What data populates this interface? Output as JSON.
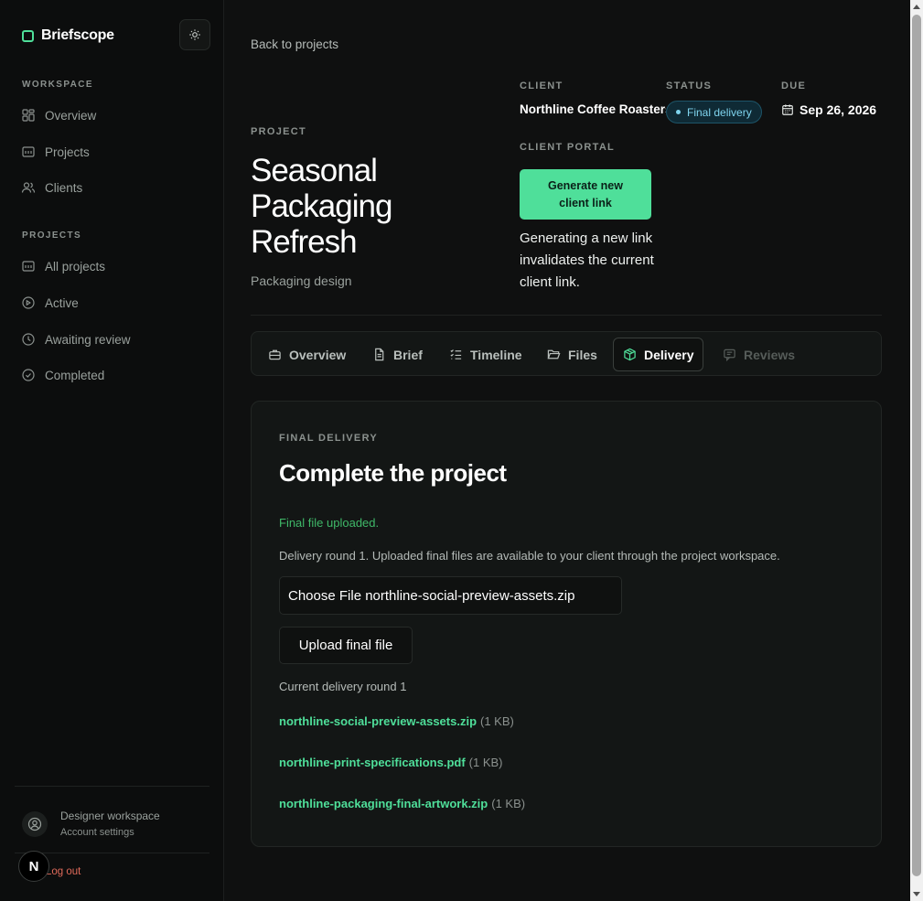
{
  "brand": {
    "name": "Briefscope",
    "accent": "#4fdf9a"
  },
  "sidebar": {
    "workspace_label": "WORKSPACE",
    "workspace_items": [
      {
        "label": "Overview",
        "icon": "dashboard-icon"
      },
      {
        "label": "Projects",
        "icon": "folder-icon"
      },
      {
        "label": "Clients",
        "icon": "users-icon"
      }
    ],
    "projects_label": "PROJECTS",
    "project_items": [
      {
        "label": "All projects",
        "icon": "folder-icon"
      },
      {
        "label": "Active",
        "icon": "circle-icon"
      },
      {
        "label": "Awaiting review",
        "icon": "clock-icon"
      },
      {
        "label": "Completed",
        "icon": "check-circle-icon"
      }
    ],
    "user": {
      "title": "Designer workspace",
      "subtitle": "Account settings"
    },
    "logout": "Log out",
    "next_badge": "N"
  },
  "header": {
    "back_link": "Back to projects",
    "project_label": "PROJECT",
    "project_title": "Seasonal Packaging Refresh",
    "project_type": "Packaging design",
    "client_label": "CLIENT",
    "client_name": "Northline Coffee Roasters",
    "status_label": "STATUS",
    "status_value": "Final delivery",
    "due_label": "DUE",
    "due_value": "Sep 26, 2026",
    "portal_label": "CLIENT PORTAL",
    "generate_button": "Generate new client link",
    "generate_note": "Generating a new link invalidates the current client link."
  },
  "tabs": [
    {
      "label": "Overview",
      "icon": "briefcase-icon",
      "state": "normal"
    },
    {
      "label": "Brief",
      "icon": "document-icon",
      "state": "normal"
    },
    {
      "label": "Timeline",
      "icon": "list-check-icon",
      "state": "normal"
    },
    {
      "label": "Files",
      "icon": "folder-open-icon",
      "state": "normal"
    },
    {
      "label": "Delivery",
      "icon": "package-icon",
      "state": "active"
    },
    {
      "label": "Reviews",
      "icon": "message-icon",
      "state": "disabled"
    }
  ],
  "delivery": {
    "section_label": "FINAL DELIVERY",
    "title": "Complete the project",
    "success_message": "Final file uploaded.",
    "note": "Delivery round 1. Uploaded final files are available to your client through the project workspace.",
    "file_input_value": "Choose File northline-social-preview-assets.zip",
    "upload_button": "Upload final file",
    "round_label": "Current delivery round 1",
    "files": [
      {
        "name": "northline-social-preview-assets.zip",
        "size": "(1 KB)"
      },
      {
        "name": "northline-print-specifications.pdf",
        "size": "(1 KB)"
      },
      {
        "name": "northline-packaging-final-artwork.zip",
        "size": "(1 KB)"
      }
    ]
  }
}
